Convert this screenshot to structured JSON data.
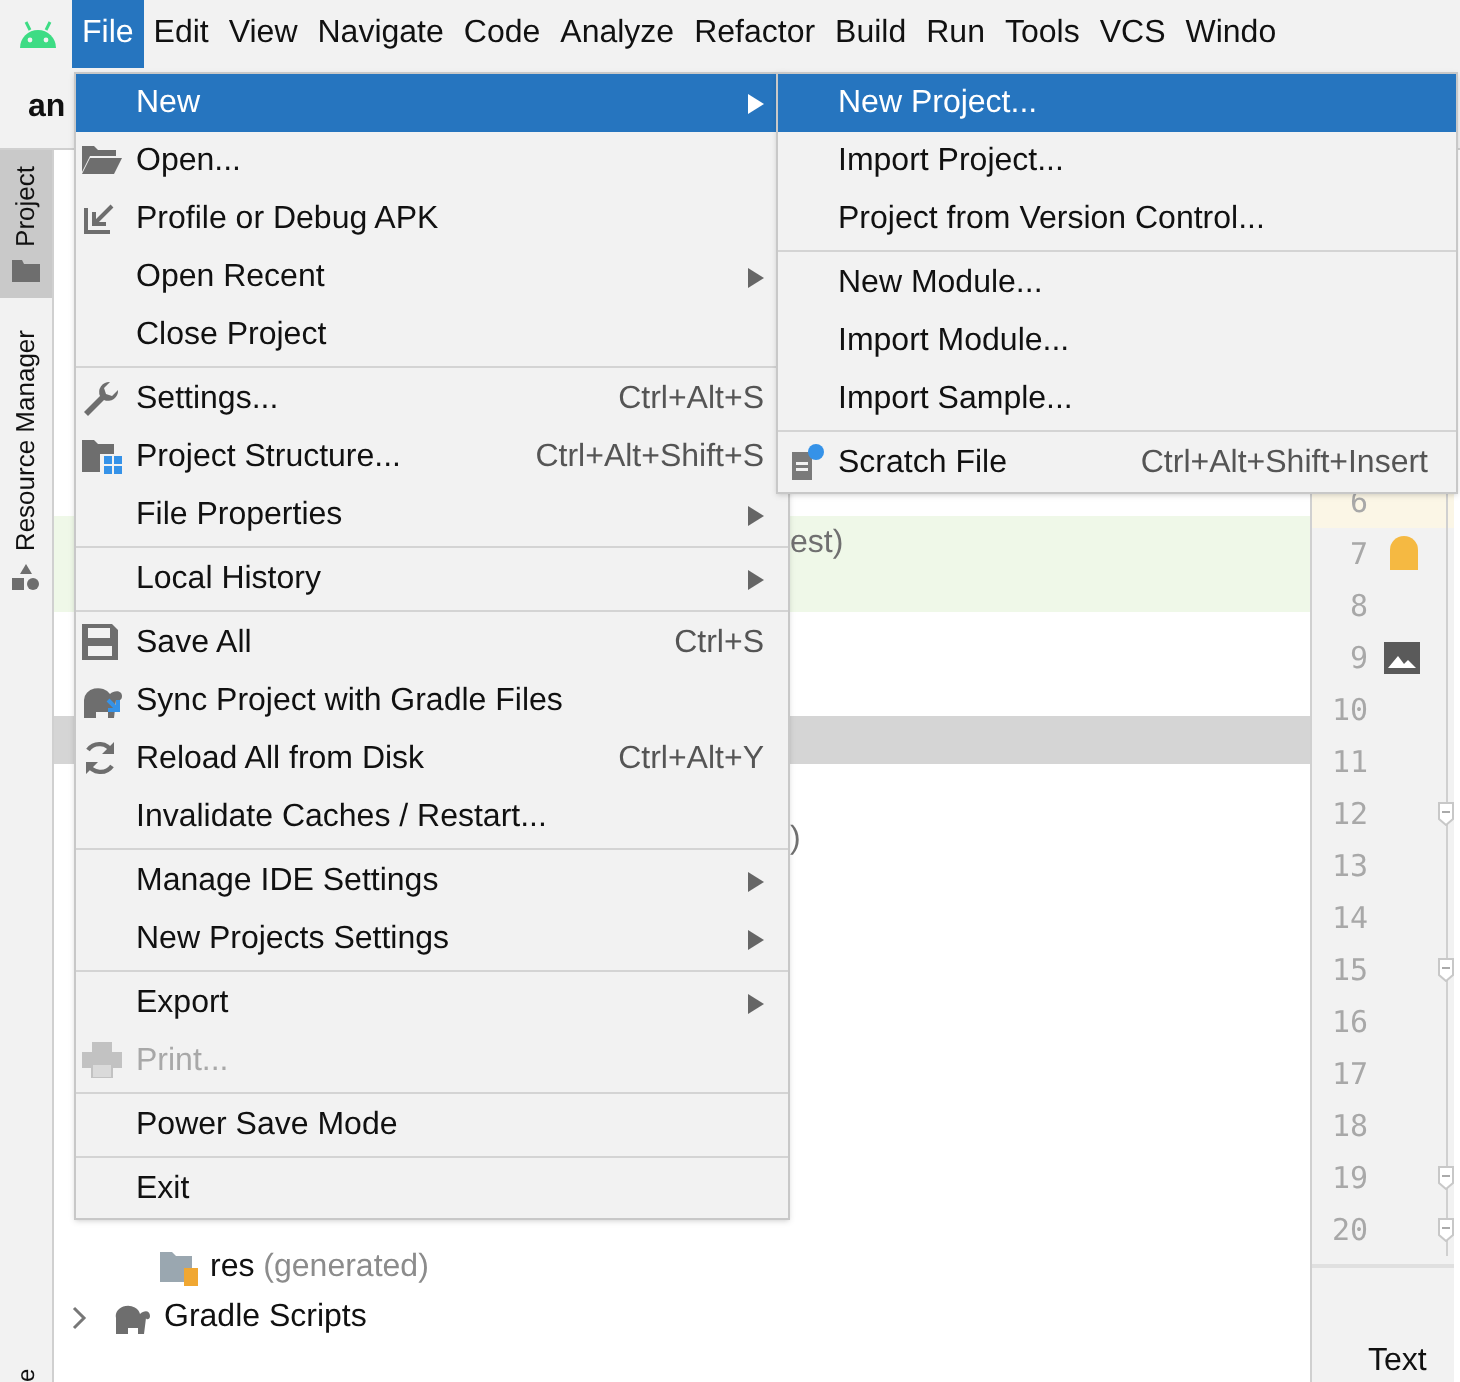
{
  "menubar": {
    "items": [
      {
        "label": "File",
        "selected": true
      },
      {
        "label": "Edit",
        "selected": false
      },
      {
        "label": "View",
        "selected": false
      },
      {
        "label": "Navigate",
        "selected": false
      },
      {
        "label": "Code",
        "selected": false
      },
      {
        "label": "Analyze",
        "selected": false
      },
      {
        "label": "Refactor",
        "selected": false
      },
      {
        "label": "Build",
        "selected": false
      },
      {
        "label": "Run",
        "selected": false
      },
      {
        "label": "Tools",
        "selected": false
      },
      {
        "label": "VCS",
        "selected": false
      },
      {
        "label": "Windo",
        "selected": false
      }
    ]
  },
  "toolbar": {
    "title": "an"
  },
  "side_strip": {
    "tabs": [
      {
        "label": "Project",
        "selected": true
      },
      {
        "label": "Resource Manager",
        "selected": false
      }
    ],
    "bottom_label": "e"
  },
  "project_tree": {
    "rows": [
      {
        "kind": "fragment",
        "label": "est)"
      },
      {
        "kind": "selection"
      },
      {
        "kind": "fragment",
        "label": ")"
      },
      {
        "kind": "folder",
        "label": "res",
        "note": "(generated)"
      },
      {
        "kind": "group",
        "label": "Gradle Scripts"
      }
    ]
  },
  "gutter": {
    "lines": [
      {
        "number": "6",
        "current": true,
        "fold": false
      },
      {
        "number": "7",
        "current": false,
        "fold": false
      },
      {
        "number": "8",
        "current": false,
        "fold": false
      },
      {
        "number": "9",
        "current": false,
        "fold": false
      },
      {
        "number": "10",
        "current": false,
        "fold": false
      },
      {
        "number": "11",
        "current": false,
        "fold": false
      },
      {
        "number": "12",
        "current": false,
        "fold": true
      },
      {
        "number": "13",
        "current": false,
        "fold": false
      },
      {
        "number": "14",
        "current": false,
        "fold": false
      },
      {
        "number": "15",
        "current": false,
        "fold": true
      },
      {
        "number": "16",
        "current": false,
        "fold": false
      },
      {
        "number": "17",
        "current": false,
        "fold": false
      },
      {
        "number": "18",
        "current": false,
        "fold": false
      },
      {
        "number": "19",
        "current": false,
        "fold": true
      },
      {
        "number": "20",
        "current": false,
        "fold": true
      }
    ],
    "bottom_tab": "Text"
  },
  "file_menu": {
    "groups": [
      [
        {
          "label": "New",
          "submenu": true,
          "selected": true,
          "disabled": false
        },
        {
          "label": "Open...",
          "submenu": false,
          "selected": false,
          "disabled": false
        },
        {
          "label": "Profile or Debug APK",
          "submenu": false,
          "selected": false,
          "disabled": false
        },
        {
          "label": "Open Recent",
          "submenu": true,
          "selected": false,
          "disabled": false
        },
        {
          "label": "Close Project",
          "submenu": false,
          "selected": false,
          "disabled": false
        }
      ],
      [
        {
          "label": "Settings...",
          "shortcut": "Ctrl+Alt+S",
          "submenu": false,
          "selected": false,
          "disabled": false
        },
        {
          "label": "Project Structure...",
          "shortcut": "Ctrl+Alt+Shift+S",
          "submenu": false,
          "selected": false,
          "disabled": false
        },
        {
          "label": "File Properties",
          "submenu": true,
          "selected": false,
          "disabled": false
        }
      ],
      [
        {
          "label": "Local History",
          "submenu": true,
          "selected": false,
          "disabled": false
        }
      ],
      [
        {
          "label": "Save All",
          "shortcut": "Ctrl+S",
          "submenu": false,
          "selected": false,
          "disabled": false
        },
        {
          "label": "Sync Project with Gradle Files",
          "submenu": false,
          "selected": false,
          "disabled": false
        },
        {
          "label": "Reload All from Disk",
          "shortcut": "Ctrl+Alt+Y",
          "submenu": false,
          "selected": false,
          "disabled": false
        },
        {
          "label": "Invalidate Caches / Restart...",
          "submenu": false,
          "selected": false,
          "disabled": false
        }
      ],
      [
        {
          "label": "Manage IDE Settings",
          "submenu": true,
          "selected": false,
          "disabled": false
        },
        {
          "label": "New Projects Settings",
          "submenu": true,
          "selected": false,
          "disabled": false
        }
      ],
      [
        {
          "label": "Export",
          "submenu": true,
          "selected": false,
          "disabled": false
        },
        {
          "label": "Print...",
          "submenu": false,
          "selected": false,
          "disabled": true
        }
      ],
      [
        {
          "label": "Power Save Mode",
          "submenu": false,
          "selected": false,
          "disabled": false
        }
      ],
      [
        {
          "label": "Exit",
          "submenu": false,
          "selected": false,
          "disabled": false
        }
      ]
    ]
  },
  "new_submenu": {
    "groups": [
      [
        {
          "label": "New Project...",
          "selected": true
        },
        {
          "label": "Import Project...",
          "selected": false
        },
        {
          "label": "Project from Version Control...",
          "selected": false
        }
      ],
      [
        {
          "label": "New Module...",
          "selected": false
        },
        {
          "label": "Import Module...",
          "selected": false
        },
        {
          "label": "Import Sample...",
          "selected": false
        }
      ],
      [
        {
          "label": "Scratch File",
          "shortcut": "Ctrl+Alt+Shift+Insert",
          "selected": false
        }
      ]
    ]
  }
}
